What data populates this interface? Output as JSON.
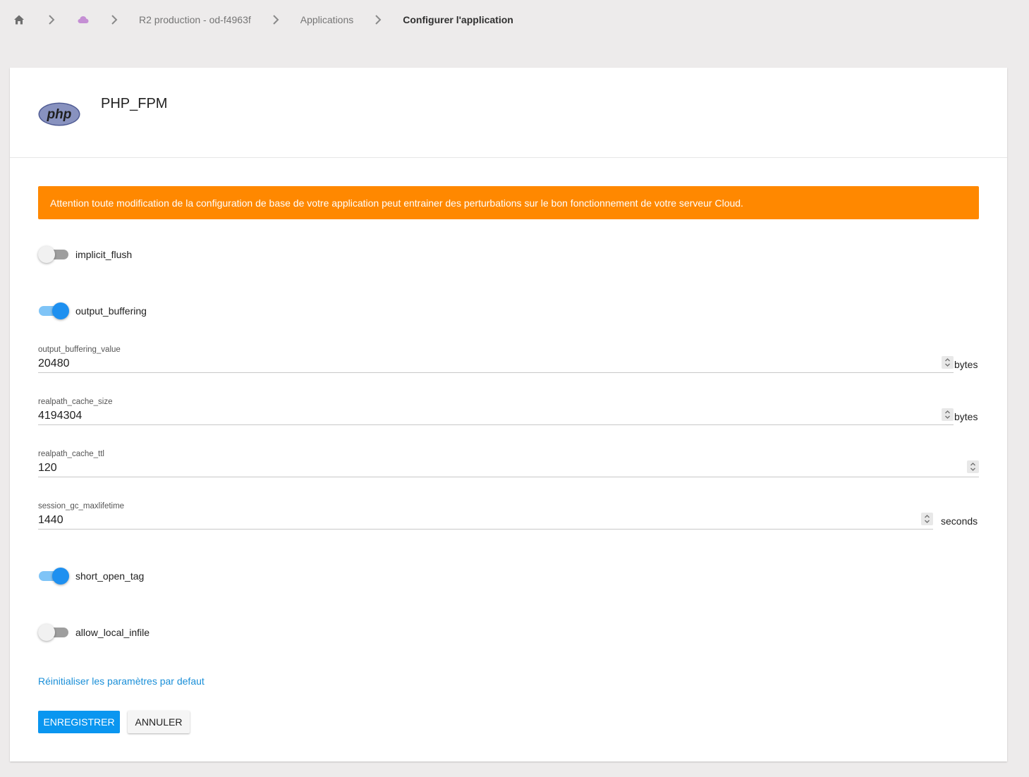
{
  "breadcrumb": {
    "home_icon": "home-icon",
    "cloud_icon": "cloud-icon",
    "separator_icon": "chevron-right-icon",
    "server": "R2 production - od-f4963f",
    "applications": "Applications",
    "current": "Configurer l'application"
  },
  "app": {
    "logo_text": "php",
    "name": "PHP_FPM"
  },
  "warning": {
    "text": "Attention toute modification de la configuration de base de votre application peut entrainer des perturbations sur le bon fonctionnement de votre serveur Cloud.",
    "color": "#ff8800"
  },
  "settings": {
    "implicit_flush": {
      "label": "implicit_flush",
      "enabled": false
    },
    "output_buffering": {
      "label": "output_buffering",
      "enabled": true
    },
    "output_buffering_value": {
      "label": "output_buffering_value",
      "value": "20480",
      "unit": "bytes"
    },
    "realpath_cache_size": {
      "label": "realpath_cache_size",
      "value": "4194304",
      "unit": "bytes"
    },
    "realpath_cache_ttl": {
      "label": "realpath_cache_ttl",
      "value": "120"
    },
    "session_gc_maxlifetime": {
      "label": "session_gc_maxlifetime",
      "value": "1440",
      "unit": "seconds"
    },
    "short_open_tag": {
      "label": "short_open_tag",
      "enabled": true
    },
    "allow_local_infile": {
      "label": "allow_local_infile",
      "enabled": false
    }
  },
  "actions": {
    "reset": "Réinitialiser les paramètres par defaut",
    "save": "ENREGISTRER",
    "cancel": "ANNULER"
  },
  "colors": {
    "accent": "#0a96f0",
    "link": "#1a8fd8",
    "cloud": "#c58fd4"
  }
}
